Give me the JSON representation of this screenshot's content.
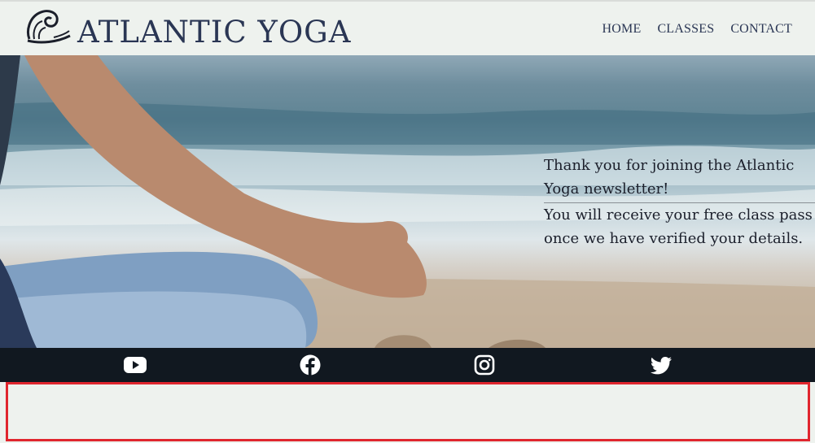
{
  "header": {
    "brand": "ATLANTIC YOGA",
    "logo_icon": "wave-logo-icon",
    "nav": [
      {
        "label": "HOME"
      },
      {
        "label": "CLASSES"
      },
      {
        "label": "CONTACT"
      }
    ]
  },
  "hero": {
    "message_line1": "Thank you for joining the Atlantic Yoga newsletter!",
    "message_line2": "You will receive your free class pass once we have verified your details."
  },
  "social": [
    {
      "icon": "youtube-icon"
    },
    {
      "icon": "facebook-icon"
    },
    {
      "icon": "instagram-icon"
    },
    {
      "icon": "twitter-icon"
    }
  ],
  "colors": {
    "brand_text": "#2a3654",
    "social_bar": "#111820",
    "highlight_border": "#e0262e",
    "page_bg": "#eef2ee"
  }
}
